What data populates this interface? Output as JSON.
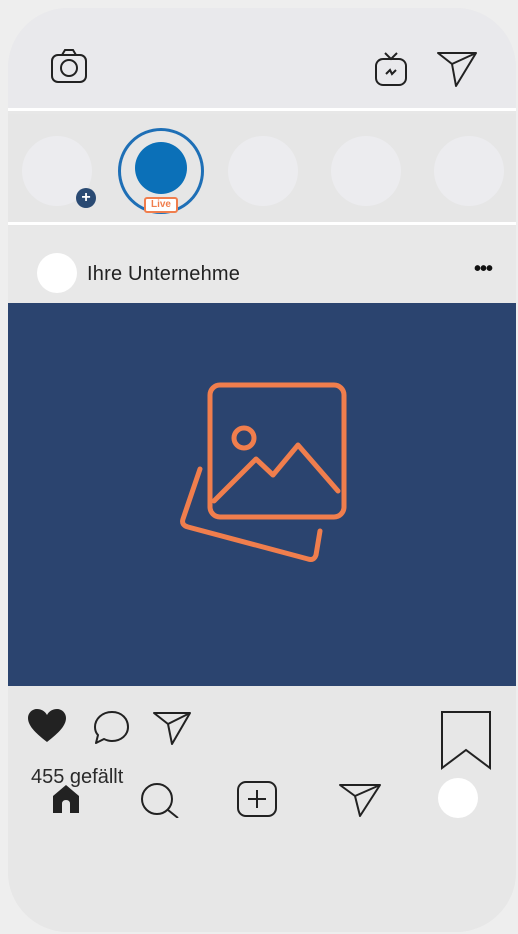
{
  "stories": {
    "live_label": "Live"
  },
  "post": {
    "username": "Ihre Unternehme",
    "more_label": "•••",
    "likes_text": "455 gefällt"
  },
  "colors": {
    "post_background": "#2b446f",
    "image_icon": "#f07e4d",
    "live_ring": "#1e6fb6",
    "live_fill": "#0b70b8",
    "badge": "#2a4a73"
  },
  "icons": {
    "header": [
      "camera-icon",
      "igtv-icon",
      "direct-message-icon"
    ],
    "actions": [
      "heart-icon",
      "comment-icon",
      "share-icon",
      "bookmark-icon"
    ],
    "nav": [
      "home-icon",
      "search-icon",
      "add-post-icon",
      "activity-send-icon",
      "profile-avatar"
    ]
  }
}
